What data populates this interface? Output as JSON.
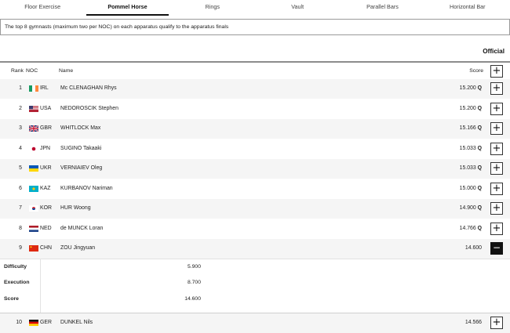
{
  "tabs": [
    {
      "label": "Floor Exercise",
      "active": false
    },
    {
      "label": "Pommel Horse",
      "active": true
    },
    {
      "label": "Rings",
      "active": false
    },
    {
      "label": "Vault",
      "active": false
    },
    {
      "label": "Parallel Bars",
      "active": false
    },
    {
      "label": "Horizontal Bar",
      "active": false
    }
  ],
  "notice": "The top 8 gymnasts (maximum two per NOC) on each apparatus qualify to the apparatus finals",
  "status": "Official",
  "header": {
    "rank": "Rank",
    "noc": "NOC",
    "name": "Name",
    "score": "Score",
    "expand": "+"
  },
  "rows": [
    {
      "rank": "1",
      "noc": "IRL",
      "flag": "irl",
      "name": "Mc CLENAGHAN Rhys",
      "score": "15.200",
      "q": "Q",
      "expand": "+"
    },
    {
      "rank": "2",
      "noc": "USA",
      "flag": "usa",
      "name": "NEDOROSCIK Stephen",
      "score": "15.200",
      "q": "Q",
      "expand": "+"
    },
    {
      "rank": "3",
      "noc": "GBR",
      "flag": "gbr",
      "name": "WHITLOCK Max",
      "score": "15.166",
      "q": "Q",
      "expand": "+"
    },
    {
      "rank": "4",
      "noc": "JPN",
      "flag": "jpn",
      "name": "SUGINO Takaaki",
      "score": "15.033",
      "q": "Q",
      "expand": "+"
    },
    {
      "rank": "5",
      "noc": "UKR",
      "flag": "ukr",
      "name": "VERNIAIEV Oleg",
      "score": "15.033",
      "q": "Q",
      "expand": "+"
    },
    {
      "rank": "6",
      "noc": "KAZ",
      "flag": "kaz",
      "name": "KURBANOV Nariman",
      "score": "15.000",
      "q": "Q",
      "expand": "+"
    },
    {
      "rank": "7",
      "noc": "KOR",
      "flag": "kor",
      "name": "HUR Woong",
      "score": "14.900",
      "q": "Q",
      "expand": "+"
    },
    {
      "rank": "8",
      "noc": "NED",
      "flag": "ned",
      "name": "de MUNCK Loran",
      "score": "14.766",
      "q": "Q",
      "expand": "+"
    },
    {
      "rank": "9",
      "noc": "CHN",
      "flag": "chn",
      "name": "ZOU Jingyuan",
      "score": "14.600",
      "q": "",
      "expand": "−",
      "open": true
    }
  ],
  "detail": [
    {
      "label": "Difficulty",
      "value": "5.900"
    },
    {
      "label": "Execution",
      "value": "8.700"
    },
    {
      "label": "Score",
      "value": "14.600"
    }
  ],
  "last_row": {
    "rank": "10",
    "noc": "GER",
    "flag": "ger",
    "name": "DUNKEL Nils",
    "score": "14.566",
    "q": "",
    "expand": "+"
  },
  "colors": {
    "accent": "#111111",
    "alt_row": "#f5f5f5",
    "border": "#9a9a9a"
  }
}
